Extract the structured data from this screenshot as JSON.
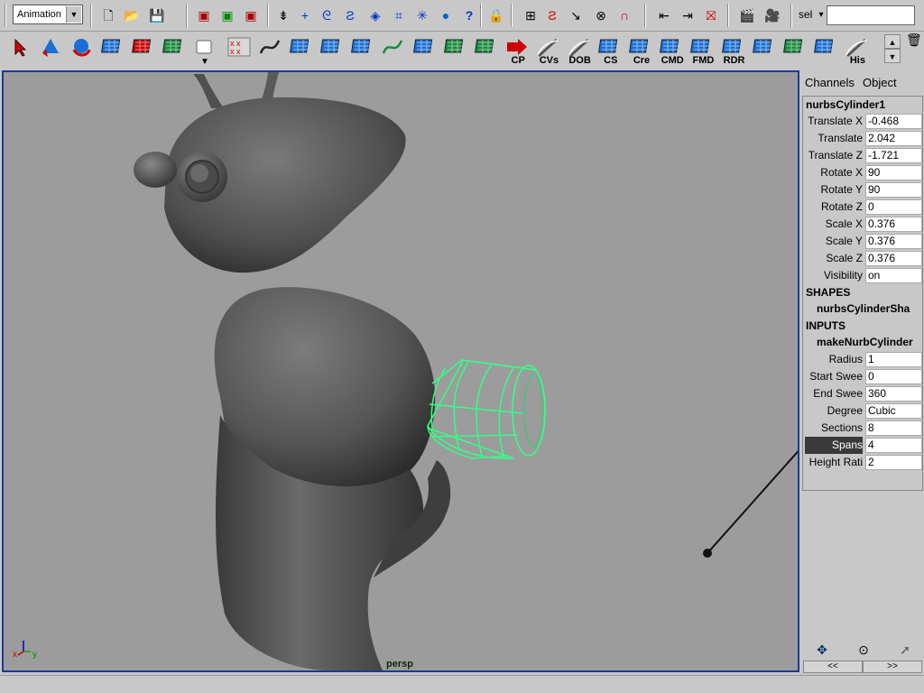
{
  "status_line": {
    "menu_set": "Animation",
    "select_label": "sel",
    "select_value": ""
  },
  "shelf": {
    "buttons": [
      {
        "icon": "select-arrow-icon",
        "label": ""
      },
      {
        "icon": "cone-icon",
        "label": ""
      },
      {
        "icon": "sphere-icon",
        "label": ""
      },
      {
        "icon": "cube-icon",
        "label": ""
      },
      {
        "icon": "move-manip-icon",
        "label": ""
      },
      {
        "icon": "plane-icon",
        "label": ""
      },
      {
        "icon": "square-button-icon",
        "label": ""
      },
      {
        "icon": "cv-curve-icon",
        "label": ""
      },
      {
        "icon": "ep-curve-icon",
        "label": ""
      },
      {
        "icon": "revolve-icon",
        "label": ""
      },
      {
        "icon": "loft-icon",
        "label": ""
      },
      {
        "icon": "planar-icon",
        "label": ""
      },
      {
        "icon": "curve-icon",
        "label": ""
      },
      {
        "icon": "extrude-icon",
        "label": ""
      },
      {
        "icon": "boundary-icon",
        "label": ""
      },
      {
        "icon": "normals-icon",
        "label": ""
      },
      {
        "icon": "cp-icon",
        "label": "CP"
      },
      {
        "icon": "cvs-icon",
        "label": "CVs"
      },
      {
        "icon": "dob-icon",
        "label": "DOB"
      },
      {
        "icon": "cs-icon",
        "label": "CS"
      },
      {
        "icon": "cre-icon",
        "label": "Cre"
      },
      {
        "icon": "cmd-icon",
        "label": "CMD"
      },
      {
        "icon": "fmd-icon",
        "label": "FMD"
      },
      {
        "icon": "rdr-icon",
        "label": "RDR"
      },
      {
        "icon": "pivot-icon",
        "label": ""
      },
      {
        "icon": "lattice-icon",
        "label": ""
      },
      {
        "icon": "paint-icon",
        "label": ""
      },
      {
        "icon": "history-icon",
        "label": "His"
      }
    ]
  },
  "viewport": {
    "camera": "persp",
    "axis_x": "x",
    "axis_y": "y"
  },
  "channel_box": {
    "tab_channels": "Channels",
    "tab_object": "Object",
    "object_name": "nurbsCylinder1",
    "transform": [
      {
        "name": "Translate X",
        "value": "-0.468"
      },
      {
        "name": "Translate",
        "value": "2.042"
      },
      {
        "name": "Translate Z",
        "value": "-1.721"
      },
      {
        "name": "Rotate X",
        "value": "90"
      },
      {
        "name": "Rotate Y",
        "value": "90"
      },
      {
        "name": "Rotate Z",
        "value": "0"
      },
      {
        "name": "Scale X",
        "value": "0.376"
      },
      {
        "name": "Scale Y",
        "value": "0.376"
      },
      {
        "name": "Scale Z",
        "value": "0.376"
      },
      {
        "name": "Visibility",
        "value": "on"
      }
    ],
    "shapes_header": "SHAPES",
    "shape_name": "nurbsCylinderSha",
    "inputs_header": "INPUTS",
    "input_name": "makeNurbCylinder",
    "inputs": [
      {
        "name": "Radius",
        "value": "1"
      },
      {
        "name": "Start Swee",
        "value": "0"
      },
      {
        "name": "End Swee",
        "value": "360"
      },
      {
        "name": "Degree",
        "value": "Cubic"
      },
      {
        "name": "Sections",
        "value": "8"
      },
      {
        "name": "Spans",
        "value": "4",
        "selected": true
      },
      {
        "name": "Height Rati",
        "value": "2"
      }
    ],
    "nav_prev": "<<",
    "nav_next": ">>"
  },
  "colors": {
    "viewport_bg": "#9c9c9c",
    "active_border": "#1e3a8c",
    "wireframe": "#33ff88",
    "ui_bg": "#c8c8c8"
  }
}
